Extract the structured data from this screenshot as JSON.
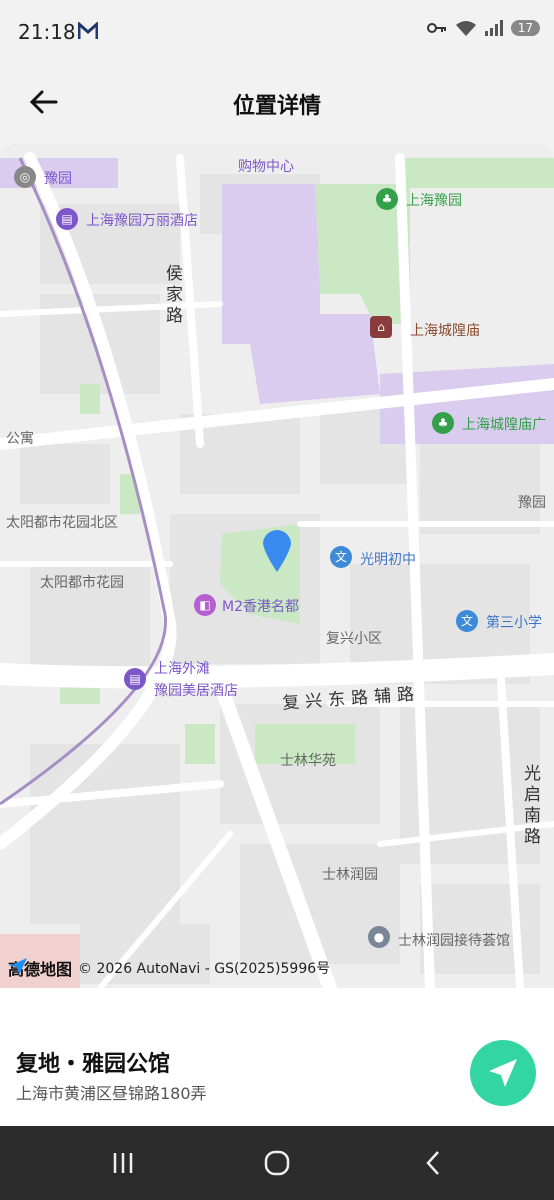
{
  "status_bar": {
    "time": "21:18",
    "battery": "17"
  },
  "header": {
    "title": "位置详情"
  },
  "map": {
    "labels": {
      "yuyuan": "豫园",
      "shopping": "购物中心",
      "hotel1": "上海豫园万丽酒店",
      "shanghai_yuyuan": "上海豫园",
      "houjialu": "侯家路",
      "chenghuangmiao": "上海城隍庙",
      "chenghuangmiao_square": "上海城隍庙广",
      "gongyu": "公寓",
      "taiyang_north": "太阳都市花园北区",
      "taiyang": "太阳都市花园",
      "yuyuan_right": "豫园",
      "guangming": "光明初中",
      "m2": "M2香港名都",
      "fuxing_community": "复兴小区",
      "third_school": "第三小学",
      "hotel2_line1": "上海外滩",
      "hotel2_line2": "豫园美居酒店",
      "fuxing_road": "复兴东路辅路",
      "shilin_huayuan": "士林华苑",
      "guangqi_road": "光启南路",
      "shilin_runyuan": "士林润园",
      "shilin_hotel": "士林润园接待荟馆"
    },
    "attribution": {
      "brand": "高德地图",
      "copyright": "© 2026 AutoNavi - GS(2025)5996号"
    }
  },
  "place": {
    "name": "复地・雅园公馆",
    "address": "上海市黄浦区昼锦路180弄"
  }
}
